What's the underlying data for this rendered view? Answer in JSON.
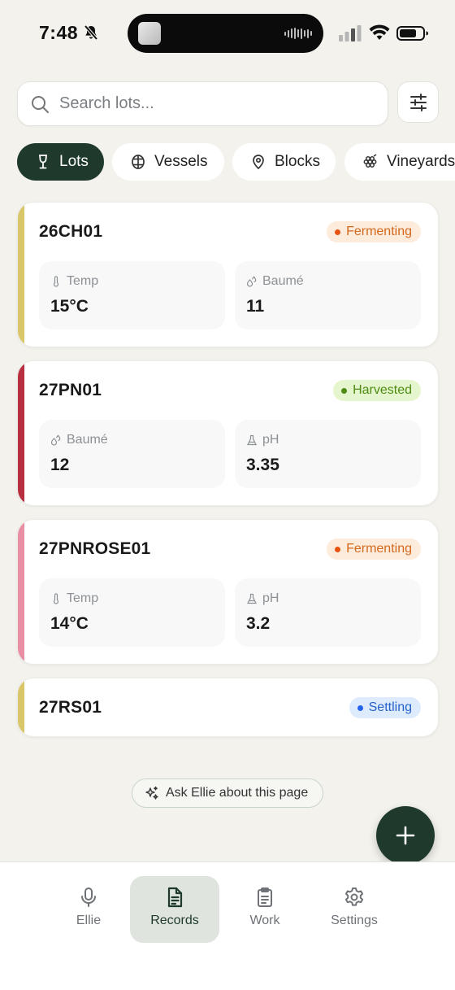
{
  "status_bar": {
    "time": "7:48"
  },
  "search": {
    "placeholder": "Search lots..."
  },
  "chips": [
    {
      "label": "Lots",
      "icon": "wine-glass-icon",
      "active": true
    },
    {
      "label": "Vessels",
      "icon": "barrel-icon",
      "active": false
    },
    {
      "label": "Blocks",
      "icon": "map-pin-icon",
      "active": false
    },
    {
      "label": "Vineyards",
      "icon": "grapes-icon",
      "active": false
    }
  ],
  "lots": [
    {
      "name": "26CH01",
      "stripe_color": "#d8c668",
      "status": {
        "label": "Fermenting",
        "bg": "#fdebdb",
        "color": "#d2691e",
        "dot": "#e8540f"
      },
      "metrics": [
        {
          "label": "Temp",
          "icon": "thermometer-icon",
          "value": "15°C"
        },
        {
          "label": "Baumé",
          "icon": "droplets-icon",
          "value": "11"
        }
      ]
    },
    {
      "name": "27PN01",
      "stripe_color": "#b8303f",
      "status": {
        "label": "Harvested",
        "bg": "#e5f6cf",
        "color": "#4e8b12",
        "dot": "#4e8b12"
      },
      "metrics": [
        {
          "label": "Baumé",
          "icon": "droplets-icon",
          "value": "12"
        },
        {
          "label": "pH",
          "icon": "flask-icon",
          "value": "3.35"
        }
      ]
    },
    {
      "name": "27PNROSE01",
      "stripe_color": "#e88fa4",
      "status": {
        "label": "Fermenting",
        "bg": "#fdebdb",
        "color": "#d2691e",
        "dot": "#e8540f"
      },
      "metrics": [
        {
          "label": "Temp",
          "icon": "thermometer-icon",
          "value": "14°C"
        },
        {
          "label": "pH",
          "icon": "flask-icon",
          "value": "3.2"
        }
      ]
    },
    {
      "name": "27RS01",
      "stripe_color": "#d8c668",
      "status": {
        "label": "Settling",
        "bg": "#deebfd",
        "color": "#2563c9",
        "dot": "#2563eb"
      },
      "metrics": []
    }
  ],
  "ask_ellie": {
    "label": "Ask Ellie about this page"
  },
  "nav": [
    {
      "label": "Ellie",
      "icon": "microphone-icon",
      "active": false
    },
    {
      "label": "Records",
      "icon": "document-icon",
      "active": true
    },
    {
      "label": "Work",
      "icon": "clipboard-icon",
      "active": false
    },
    {
      "label": "Settings",
      "icon": "gear-icon",
      "active": false
    }
  ]
}
